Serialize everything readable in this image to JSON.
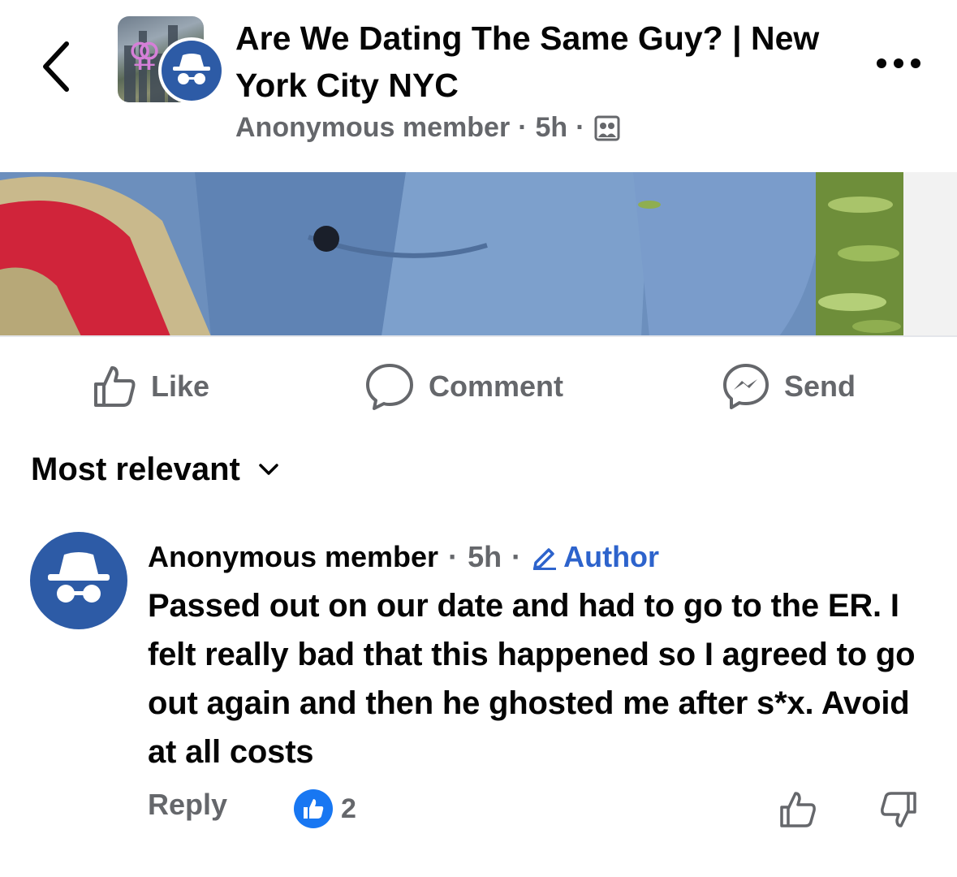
{
  "header": {
    "title": "Are We Dating The Same Guy? | New York City NYC",
    "author": "Anonymous member",
    "time": "5h",
    "separator": "·",
    "audience_icon": "group-members-icon",
    "back_icon": "chevron-left-icon",
    "more_icon": "more-horizontal-icon"
  },
  "actions": {
    "like_label": "Like",
    "comment_label": "Comment",
    "send_label": "Send"
  },
  "sort": {
    "label": "Most relevant",
    "icon": "chevron-down-icon"
  },
  "comment": {
    "author": "Anonymous member",
    "time": "5h",
    "separator": "·",
    "badge": "Author",
    "text": "Passed out on our date and had to go to the ER. I felt really bad that this happened so I agreed to go out again and then he ghosted me after s*x. Avoid at all costs",
    "reply_label": "Reply",
    "reaction_count": "2"
  },
  "colors": {
    "accent_blue": "#1877f2",
    "anon_blue": "#2d5ba6",
    "author_blue": "#2d63cc",
    "meta_gray": "#65676b",
    "text": "#050505"
  }
}
